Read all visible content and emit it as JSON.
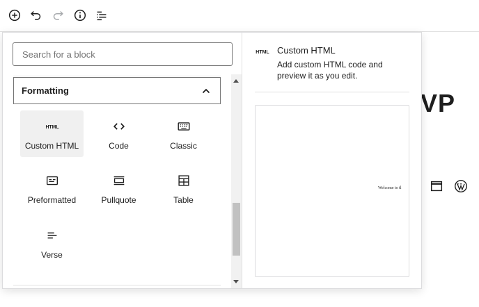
{
  "toolbar": {
    "buttons": [
      {
        "name": "add-block-button",
        "icon": "plus-circle-icon"
      },
      {
        "name": "undo-button",
        "icon": "undo-icon"
      },
      {
        "name": "redo-button",
        "icon": "redo-icon",
        "disabled": true
      },
      {
        "name": "details-button",
        "icon": "info-icon"
      },
      {
        "name": "list-view-button",
        "icon": "list-view-icon"
      }
    ]
  },
  "background": {
    "title_fragment": "VP"
  },
  "inserter": {
    "search_placeholder": "Search for a block",
    "panel": {
      "title": "Formatting",
      "expanded": true
    },
    "blocks": [
      {
        "label": "Custom HTML",
        "icon": "html-icon",
        "active": true
      },
      {
        "label": "Code",
        "icon": "code-icon"
      },
      {
        "label": "Classic",
        "icon": "keyboard-icon"
      },
      {
        "label": "Preformatted",
        "icon": "preformatted-icon"
      },
      {
        "label": "Pullquote",
        "icon": "pullquote-icon"
      },
      {
        "label": "Table",
        "icon": "table-icon"
      },
      {
        "label": "Verse",
        "icon": "verse-icon"
      }
    ]
  },
  "preview": {
    "icon_text": "HTML",
    "name": "Custom HTML",
    "description": "Add custom HTML code and preview it as you edit.",
    "content_text": "Welcome to tl"
  },
  "colors": {
    "text": "#1e1e1e",
    "border": "#757575",
    "divider": "#e0e0e0",
    "active_bg": "#f0f0f0"
  }
}
